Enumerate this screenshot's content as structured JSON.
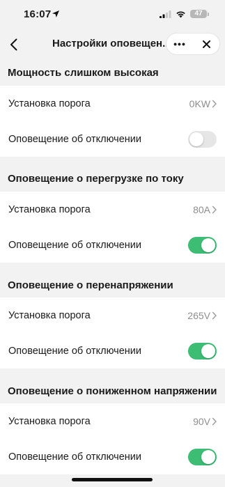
{
  "status_bar": {
    "time": "16:07",
    "battery": "47"
  },
  "nav": {
    "title": "Настройки оповещен...",
    "more": "•••"
  },
  "sections": [
    {
      "title": "Мощность слишком высокая",
      "threshold_label": "Установка порога",
      "threshold_value": "0KW",
      "alert_label": "Оповещение об отключении",
      "alert_on": false
    },
    {
      "title": "Оповещение о перегрузке по току",
      "threshold_label": "Установка порога",
      "threshold_value": "80A",
      "alert_label": "Оповещение об отключении",
      "alert_on": true
    },
    {
      "title": "Оповещение о перенапряжении",
      "threshold_label": "Установка порога",
      "threshold_value": "265V",
      "alert_label": "Оповещение об отключении",
      "alert_on": true
    },
    {
      "title": "Оповещение о пониженном напряжении",
      "threshold_label": "Установка порога",
      "threshold_value": "90V",
      "alert_label": "Оповещение об отключении",
      "alert_on": true
    }
  ],
  "colors": {
    "toggle_on": "#3dbd74",
    "toggle_off": "#e6e6e6",
    "background": "#f2f2f2"
  }
}
